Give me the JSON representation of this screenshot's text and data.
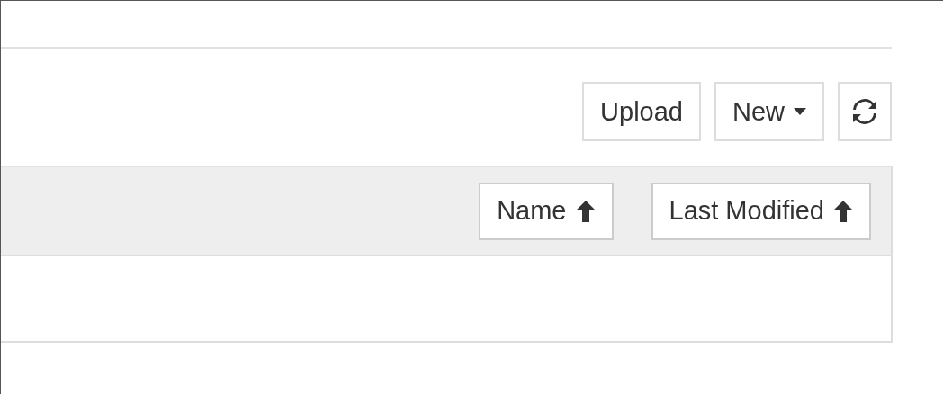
{
  "toolbar": {
    "buttons": [
      {
        "kind": "text",
        "label": "Upload"
      },
      {
        "kind": "dropdown",
        "label": "New"
      },
      {
        "kind": "refresh"
      }
    ]
  },
  "list_header": {
    "sort_buttons": [
      {
        "label": "Name",
        "ascending": true
      },
      {
        "label": "Last Modified",
        "ascending": true
      }
    ]
  }
}
